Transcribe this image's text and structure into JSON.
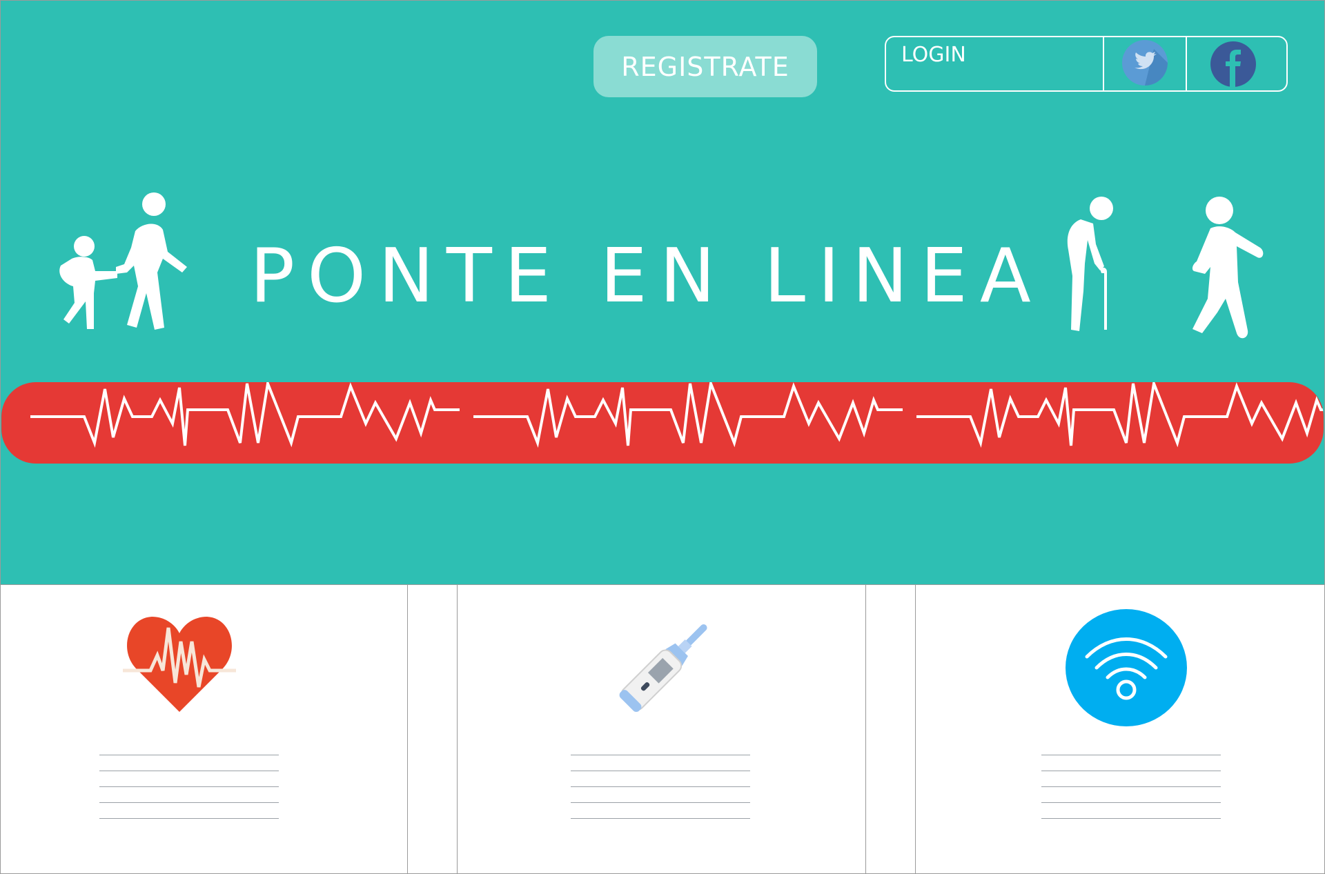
{
  "colors": {
    "teal": "#2ebfb3",
    "register_bg": "#8adcd3",
    "pulse_red": "#e53935",
    "heart_red": "#e84628",
    "wifi_blue": "#00aef0",
    "twitter_blue": "#5b9bd5",
    "facebook_blue": "#3b5998"
  },
  "header": {
    "register_label": "REGISTRATE",
    "login_label": "LOGIN",
    "social_icons": [
      "twitter-icon",
      "facebook-icon"
    ]
  },
  "hero": {
    "title": "PONTE EN LINEA",
    "figures": [
      "adult-helping-child-icon",
      "elderly-person-with-cane-icon",
      "walking-person-icon"
    ],
    "banner_icon": "heartbeat-line-icon"
  },
  "features": [
    {
      "icon": "heart-pulse-icon"
    },
    {
      "icon": "digital-thermometer-icon"
    },
    {
      "icon": "wifi-icon"
    }
  ]
}
